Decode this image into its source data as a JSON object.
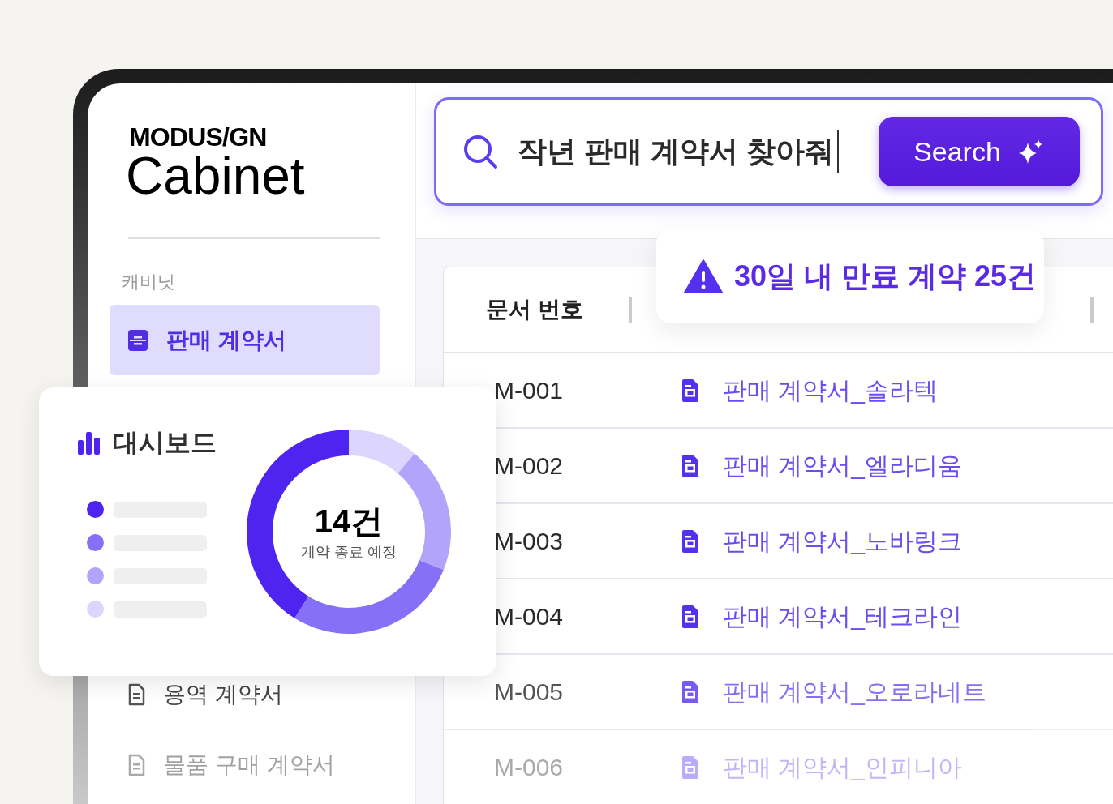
{
  "brand": {
    "company": "MODUS/GN",
    "product": "Cabinet"
  },
  "sidebar": {
    "section": "캐비닛",
    "items": [
      {
        "label": "판매 계약서",
        "selected": true
      },
      {
        "label": "용역 계약서",
        "selected": false
      },
      {
        "label": "물품 구매 계약서",
        "selected": false
      }
    ]
  },
  "search": {
    "value": "작년 판매 계약서 찾아줘",
    "button": "Search"
  },
  "alert": {
    "count_text": "30일 내 만료 계약",
    "count": "25건"
  },
  "table": {
    "columns": [
      "문서 번호"
    ],
    "rows": [
      {
        "id": "M-001",
        "name": "판매 계약서_솔라텍"
      },
      {
        "id": "M-002",
        "name": "판매 계약서_엘라디움"
      },
      {
        "id": "M-003",
        "name": "판매 계약서_노바링크"
      },
      {
        "id": "M-004",
        "name": "판매 계약서_테크라인"
      },
      {
        "id": "M-005",
        "name": "판매 계약서_오로라네트"
      },
      {
        "id": "M-006",
        "name": "판매 계약서_인피니아"
      }
    ]
  },
  "dashboard": {
    "title": "대시보드",
    "total": "14건",
    "caption": "계약 종료 예정",
    "legend": [
      {
        "color": "#4f24f0"
      },
      {
        "color": "#8770f8"
      },
      {
        "color": "#b2a4fb"
      },
      {
        "color": "#dcd5fd"
      }
    ]
  }
}
